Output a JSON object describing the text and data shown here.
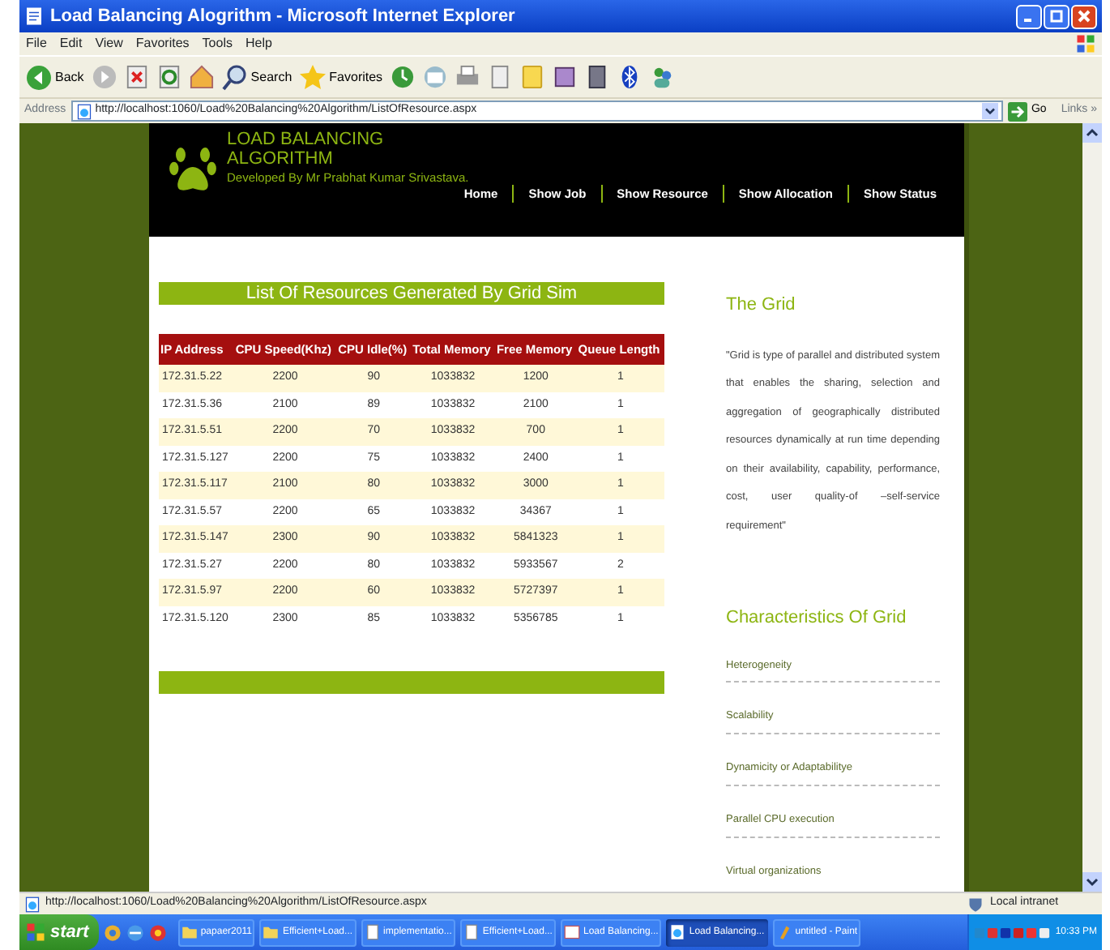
{
  "window": {
    "title": "Load Balancing Alogrithm - Microsoft Internet Explorer"
  },
  "menu": [
    "File",
    "Edit",
    "View",
    "Favorites",
    "Tools",
    "Help"
  ],
  "toolbar": [
    {
      "kind": "back",
      "label": "Back"
    },
    {
      "kind": "forward"
    },
    {
      "kind": "stop"
    },
    {
      "kind": "refresh"
    },
    {
      "kind": "home"
    },
    {
      "kind": "search",
      "label": "Search"
    },
    {
      "kind": "favorites",
      "label": "Favorites"
    },
    {
      "kind": "history"
    },
    {
      "kind": "mail"
    },
    {
      "kind": "print"
    },
    {
      "kind": "edit"
    },
    {
      "kind": "note"
    },
    {
      "kind": "research"
    },
    {
      "kind": "media"
    },
    {
      "kind": "bluetooth"
    },
    {
      "kind": "messenger"
    }
  ],
  "address": {
    "label": "Address",
    "url": "http://localhost:1060/Load%20Balancing%20Algorithm/ListOfResource.aspx",
    "go": "Go",
    "links": "Links »"
  },
  "site": {
    "title_lines": [
      "LOAD BALANCING",
      "ALGORITHM"
    ],
    "subtitle": "Developed By Mr Prabhat Kumar Srivastava.",
    "nav": [
      "Home",
      "Show Job",
      "Show Resource",
      "Show Allocation",
      "Show Status"
    ]
  },
  "resources": {
    "heading": "List Of Resources Generated By Grid Sim",
    "columns": [
      "IP Address",
      "CPU Speed(Khz)",
      "CPU Idle(%)",
      "Total Memory",
      "Free Memory",
      "Queue Length"
    ],
    "rows": [
      [
        "172.31.5.22",
        "2200",
        "90",
        "1033832",
        "1200",
        "1"
      ],
      [
        "172.31.5.36",
        "2100",
        "89",
        "1033832",
        "2100",
        "1"
      ],
      [
        "172.31.5.51",
        "2200",
        "70",
        "1033832",
        "700",
        "1"
      ],
      [
        "172.31.5.127",
        "2200",
        "75",
        "1033832",
        "2400",
        "1"
      ],
      [
        "172.31.5.117",
        "2100",
        "80",
        "1033832",
        "3000",
        "1"
      ],
      [
        "172.31.5.57",
        "2200",
        "65",
        "1033832",
        "34367",
        "1"
      ],
      [
        "172.31.5.147",
        "2300",
        "90",
        "1033832",
        "5841323",
        "1"
      ],
      [
        "172.31.5.27",
        "2200",
        "80",
        "1033832",
        "5933567",
        "2"
      ],
      [
        "172.31.5.97",
        "2200",
        "60",
        "1033832",
        "5727397",
        "1"
      ],
      [
        "172.31.5.120",
        "2300",
        "85",
        "1033832",
        "5356785",
        "1"
      ]
    ]
  },
  "sidebar": {
    "grid_title": "The Grid",
    "grid_text": "\"Grid is type of parallel and distributed system that enables the sharing, selection and aggregation of geographically distributed resources dynamically at run time depending on their availability, capability, performance, cost, user quality-of –self-service requirement\"",
    "char_title": "Characteristics Of Grid",
    "characteristics": [
      "Heterogeneity",
      "Scalability",
      "Dynamicity or Adaptabilitye",
      "Parallel CPU execution",
      "Virtual organizations"
    ]
  },
  "status_bar": {
    "url": "http://localhost:1060/Load%20Balancing%20Algorithm/ListOfResource.aspx",
    "zone": "Local intranet"
  },
  "taskbar": {
    "start": "start",
    "tasks": [
      {
        "label": "papaer2011",
        "kind": "folder",
        "selected": false
      },
      {
        "label": "Efficient+Load...",
        "kind": "folder",
        "selected": false
      },
      {
        "label": "implementatio...",
        "kind": "doc",
        "selected": false
      },
      {
        "label": "Efficient+Load...",
        "kind": "doc",
        "selected": false
      },
      {
        "label": "Load Balancing...",
        "kind": "app",
        "selected": false
      },
      {
        "label": "Load Balancing...",
        "kind": "ie",
        "selected": true
      },
      {
        "label": "untitled - Paint",
        "kind": "paint",
        "selected": false
      }
    ],
    "clock": "10:33 PM"
  }
}
